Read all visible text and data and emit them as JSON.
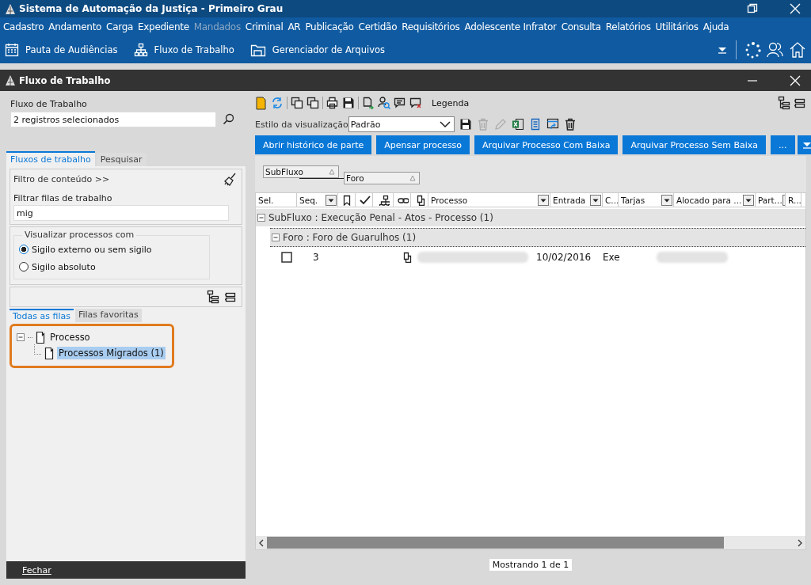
{
  "window": {
    "title": "Sistema de Automação da Justiça - Primeiro Grau"
  },
  "menu": [
    {
      "label": "Cadastro",
      "disabled": false
    },
    {
      "label": "Andamento",
      "disabled": false
    },
    {
      "label": "Carga",
      "disabled": false
    },
    {
      "label": "Expediente",
      "disabled": false
    },
    {
      "label": "Mandados",
      "disabled": true
    },
    {
      "label": "Criminal",
      "disabled": false
    },
    {
      "label": "AR",
      "disabled": false
    },
    {
      "label": "Publicação",
      "disabled": false
    },
    {
      "label": "Certidão",
      "disabled": false
    },
    {
      "label": "Requisitórios",
      "disabled": false
    },
    {
      "label": "Adolescente Infrator",
      "disabled": false
    },
    {
      "label": "Consulta",
      "disabled": false
    },
    {
      "label": "Relatórios",
      "disabled": false
    },
    {
      "label": "Utilitários",
      "disabled": false
    },
    {
      "label": "Ajuda",
      "disabled": false
    }
  ],
  "toolbar": [
    {
      "label": "Pauta de Audiências",
      "kind": "calendar"
    },
    {
      "label": "Fluxo de Trabalho",
      "kind": "hierarchy"
    },
    {
      "label": "Gerenciador de Arquivos",
      "kind": "folder"
    }
  ],
  "subwindow": {
    "title": "Fluxo de Trabalho"
  },
  "left": {
    "field_label": "Fluxo de Trabalho",
    "field_value": "2 registros selecionados",
    "tabs": [
      {
        "label": "Fluxos de trabalho",
        "selected": true
      },
      {
        "label": "Pesquisar",
        "selected": false
      }
    ],
    "filter_toggle": "Filtro de conteúdo >>",
    "filter_label": "Filtrar filas de trabalho",
    "filter_value": "mig",
    "visibility_legend": "Visualizar processos com",
    "radios": [
      {
        "label": "Sigilo externo ou sem sigilo",
        "selected": true
      },
      {
        "label": "Sigilo absoluto",
        "selected": false
      }
    ],
    "queue_tabs": [
      {
        "label": "Todas as filas",
        "selected": true
      },
      {
        "label": "Filas favoritas",
        "selected": false
      }
    ],
    "tree": [
      {
        "label": "Processo",
        "expanded": true,
        "selected": false,
        "children": [
          {
            "label": "Processos Migrados (1)",
            "selected": true
          }
        ]
      }
    ],
    "close_button": "Fechar"
  },
  "right": {
    "legend_label": "Legenda",
    "style_label": "Estilo da visualização",
    "style_value": "Padrão",
    "actions": [
      "Abrir histórico de parte",
      "Apensar processo",
      "Arquivar Processo Com Baixa",
      "Arquivar Processo Sem Baixa",
      "..."
    ],
    "group_chips": [
      "SubFluxo",
      "Foro"
    ],
    "columns": [
      {
        "label": "Sel.",
        "kind": "text"
      },
      {
        "label": "Seq.",
        "kind": "text"
      },
      {
        "kind": "bookmark"
      },
      {
        "kind": "check"
      },
      {
        "kind": "hierarchy"
      },
      {
        "kind": "link"
      },
      {
        "kind": "copy"
      },
      {
        "label": "Processo",
        "kind": "text"
      },
      {
        "label": "Entrada",
        "kind": "text"
      },
      {
        "label": "C...",
        "kind": "text"
      },
      {
        "label": "Tarjas",
        "kind": "text"
      },
      {
        "label": "Alocado para ...",
        "kind": "text"
      },
      {
        "label": "Part...",
        "kind": "text"
      },
      {
        "label": "R...",
        "kind": "text"
      }
    ],
    "groups": [
      {
        "label": "SubFluxo : Execução Penal - Atos - Processo  (1)",
        "expanded": true,
        "children": [
          {
            "label": "Foro : Foro de Guarulhos  (1)",
            "expanded": true,
            "rows": [
              {
                "checked": false,
                "seq": "3",
                "entrada": "10/02/2016",
                "c": "Exe"
              }
            ]
          }
        ]
      }
    ],
    "status": "Mostrando 1 de 1"
  }
}
